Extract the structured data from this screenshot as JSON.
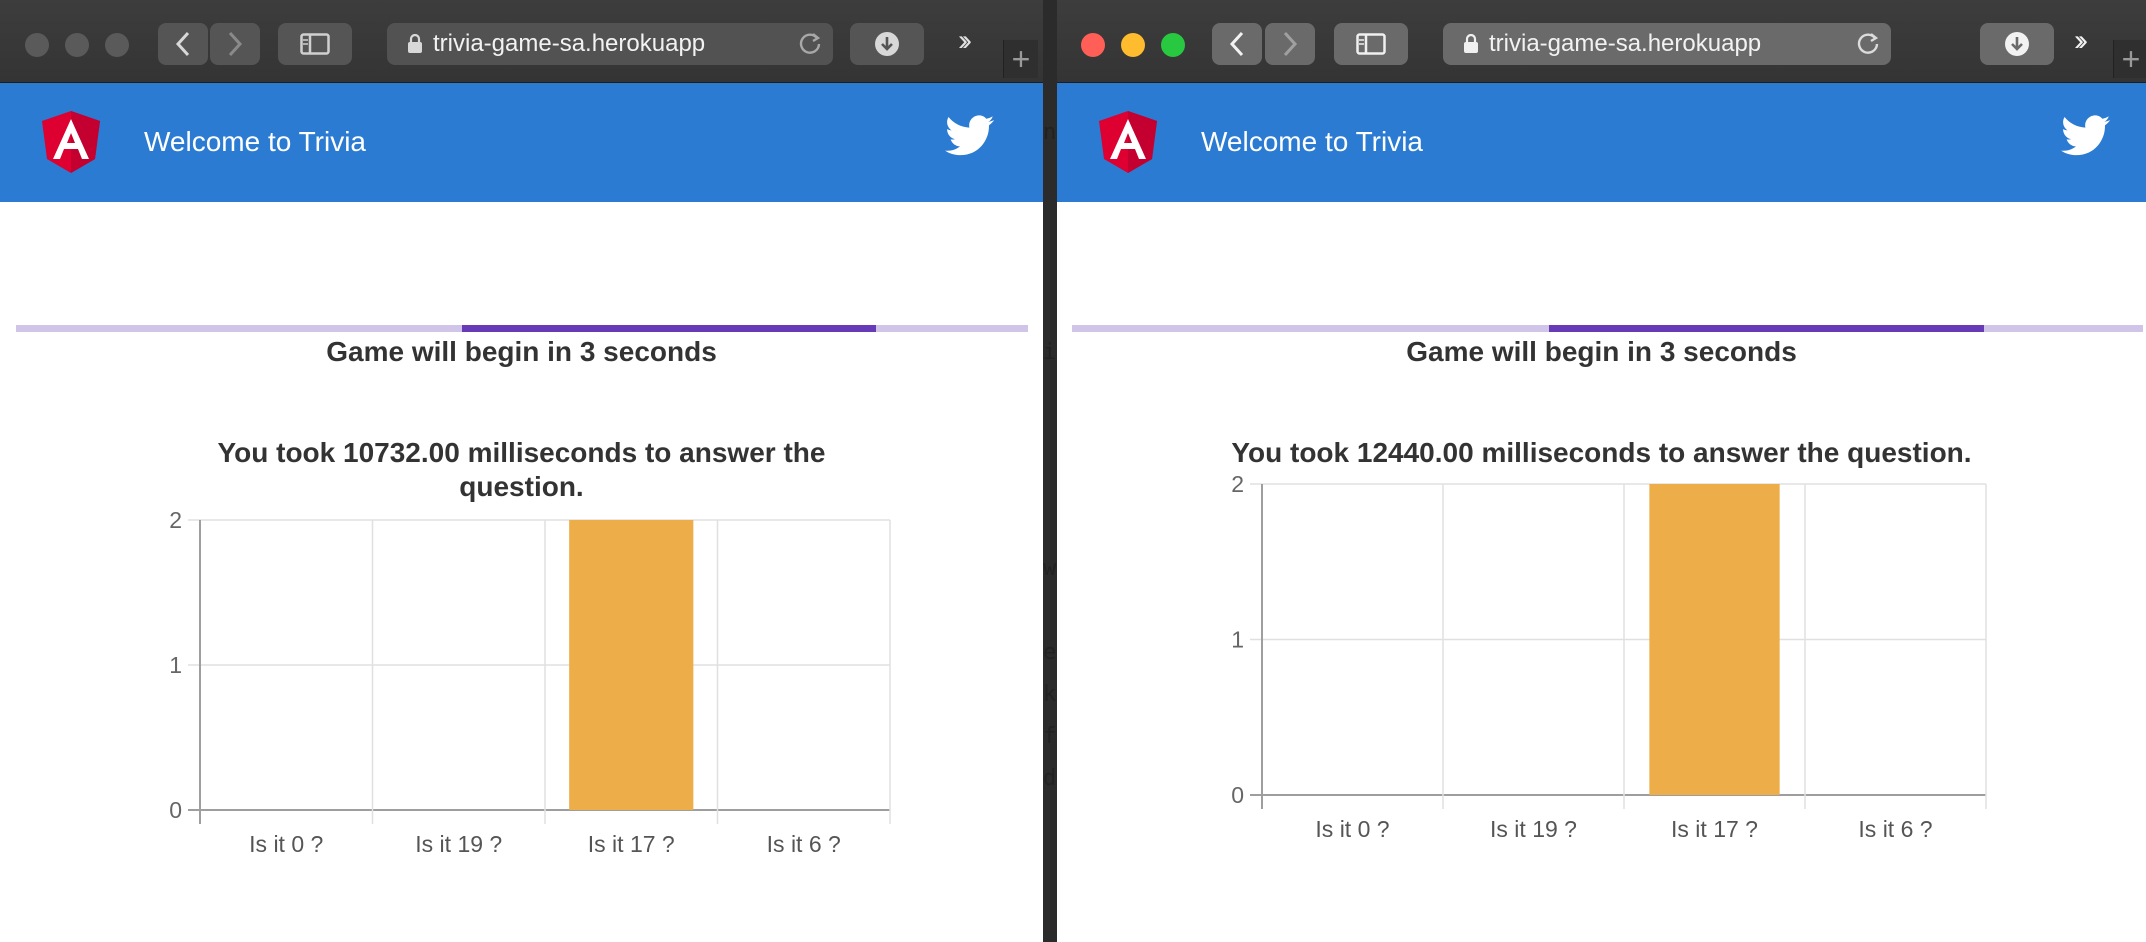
{
  "windows": [
    {
      "id": "left",
      "url": "trivia-game-sa.herokuapp",
      "app_title": "Welcome to Trivia",
      "countdown": "Game will begin in 3 seconds",
      "progress": 0.41,
      "time_message": "You took 10732.00 milliseconds to answer the question.",
      "chart_data": {
        "type": "bar",
        "categories": [
          "Is it 0 ?",
          "Is it 19 ?",
          "Is it 17 ?",
          "Is it 6 ?"
        ],
        "values": [
          0,
          0,
          2,
          0
        ],
        "ylim": [
          0,
          2
        ],
        "yticks": [
          0,
          1,
          2
        ],
        "bar_color": "#edae49",
        "grid": true
      }
    },
    {
      "id": "right",
      "url": "trivia-game-sa.herokuapp",
      "app_title": "Welcome to Trivia",
      "countdown": "Game will begin in 3 seconds",
      "progress": 0.41,
      "time_message": "You took 12440.00 milliseconds to answer the question.",
      "chart_data": {
        "type": "bar",
        "categories": [
          "Is it 0 ?",
          "Is it 19 ?",
          "Is it 17 ?",
          "Is it 6 ?"
        ],
        "values": [
          0,
          0,
          2,
          0
        ],
        "ylim": [
          0,
          2
        ],
        "yticks": [
          0,
          1,
          2
        ],
        "bar_color": "#edae49",
        "grid": true
      }
    }
  ],
  "colors": {
    "appbar": "#2b7bd3",
    "progress_track": "#d1c4e9",
    "progress_fill": "#673ab7",
    "bar": "#edae49"
  },
  "icons": [
    "angular-logo-icon",
    "twitter-icon",
    "lock-icon",
    "reload-icon",
    "download-icon",
    "sidebar-icon",
    "back-icon",
    "forward-icon",
    "more-icon",
    "new-tab-icon"
  ]
}
